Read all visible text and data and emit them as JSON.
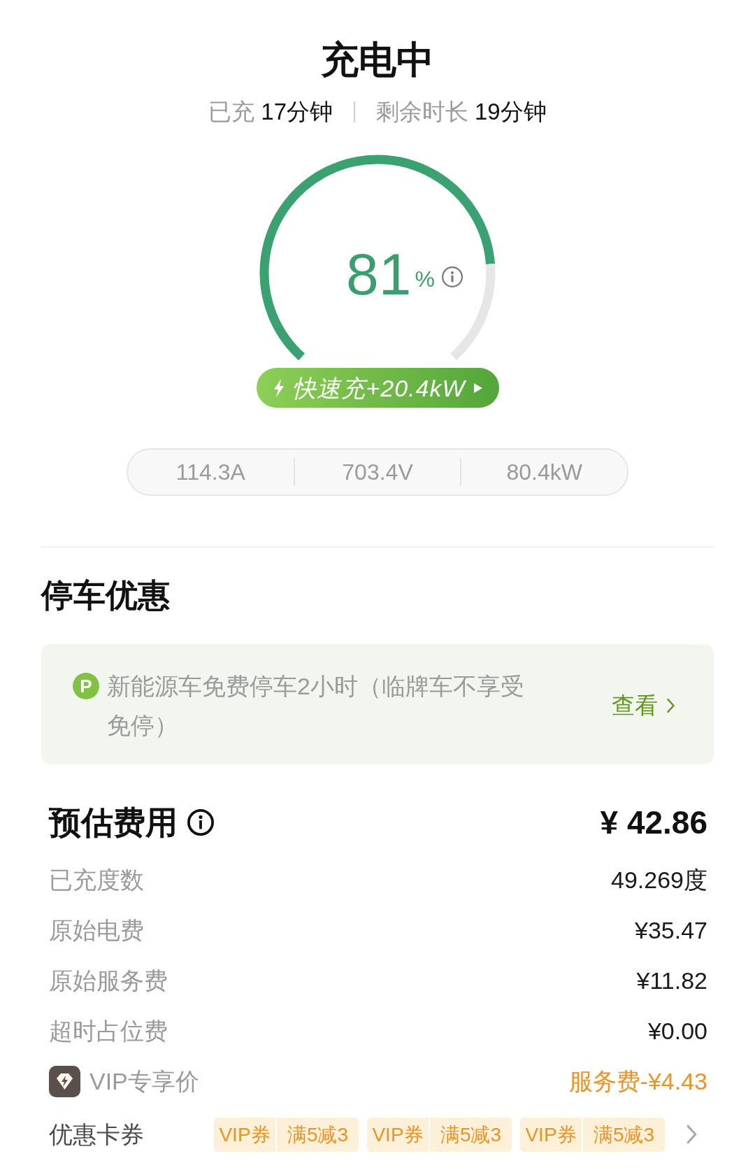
{
  "header": {
    "title": "充电中",
    "elapsed": {
      "label": "已充",
      "value": "17分钟"
    },
    "remaining": {
      "label": "剩余时长",
      "value": "19分钟"
    }
  },
  "gauge": {
    "value": "81",
    "unit": "%"
  },
  "fast_charge": {
    "label": "快速充+20.4kW"
  },
  "stats": [
    "114.3A",
    "703.4V",
    "80.4kW"
  ],
  "parking": {
    "title": "停车优惠",
    "badge": "P",
    "notice": "新能源车免费停车2小时（临牌车不享受免停）",
    "link": "查看"
  },
  "fees": {
    "title": "预估费用",
    "total": "¥ 42.86",
    "rows": [
      {
        "kind": "plain",
        "label": "已充度数",
        "value": "49.269度"
      },
      {
        "kind": "plain",
        "label": "原始电费",
        "value": "¥35.47"
      },
      {
        "kind": "plain",
        "label": "原始服务费",
        "value": "¥11.82"
      },
      {
        "kind": "plain",
        "label": "超时占位费",
        "value": "¥0.00"
      },
      {
        "kind": "vip",
        "label": "VIP专享价",
        "value": "服务费-¥4.43"
      }
    ]
  },
  "coupons": {
    "label": "优惠卡券",
    "items": [
      {
        "tag": "VIP券",
        "offer": "满5减3"
      },
      {
        "tag": "VIP券",
        "offer": "满5减3"
      },
      {
        "tag": "VIP券",
        "offer": "满5减3"
      }
    ]
  }
}
